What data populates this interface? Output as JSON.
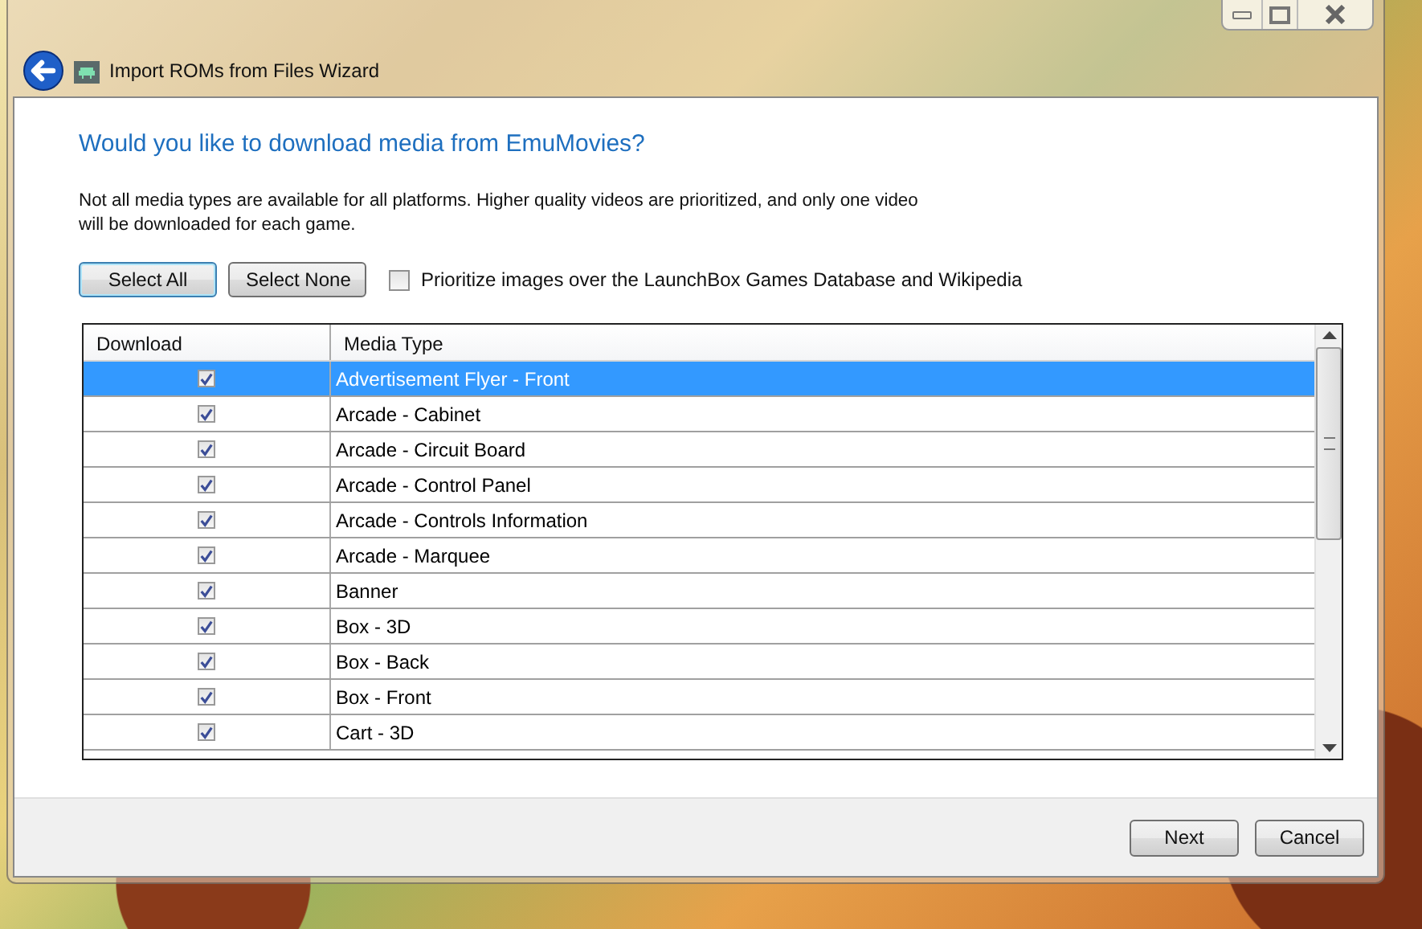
{
  "window": {
    "title": "Import ROMs from Files Wizard"
  },
  "heading": "Would you like to download media from EmuMovies?",
  "description": "Not all media types are available for all platforms. Higher quality videos are prioritized, and only one video will be downloaded for each game.",
  "select_buttons": [
    {
      "label": "Select All",
      "selected": true
    },
    {
      "label": "Select None",
      "selected": false
    }
  ],
  "prioritize_option": {
    "label": "Prioritize images over the LaunchBox Games Database and Wikipedia",
    "checked": false
  },
  "table": {
    "columns": [
      "Download",
      "Media Type"
    ],
    "rows": [
      {
        "media_type": "Advertisement Flyer - Front",
        "checked": true,
        "selected": true
      },
      {
        "media_type": "Arcade - Cabinet",
        "checked": true,
        "selected": false
      },
      {
        "media_type": "Arcade - Circuit Board",
        "checked": true,
        "selected": false
      },
      {
        "media_type": "Arcade - Control Panel",
        "checked": true,
        "selected": false
      },
      {
        "media_type": "Arcade - Controls Information",
        "checked": true,
        "selected": false
      },
      {
        "media_type": "Arcade - Marquee",
        "checked": true,
        "selected": false
      },
      {
        "media_type": "Banner",
        "checked": true,
        "selected": false
      },
      {
        "media_type": "Box - 3D",
        "checked": true,
        "selected": false
      },
      {
        "media_type": "Box - Back",
        "checked": true,
        "selected": false
      },
      {
        "media_type": "Box - Front",
        "checked": true,
        "selected": false
      },
      {
        "media_type": "Cart - 3D",
        "checked": true,
        "selected": false
      }
    ]
  },
  "footer_buttons": [
    "Next",
    "Cancel"
  ]
}
